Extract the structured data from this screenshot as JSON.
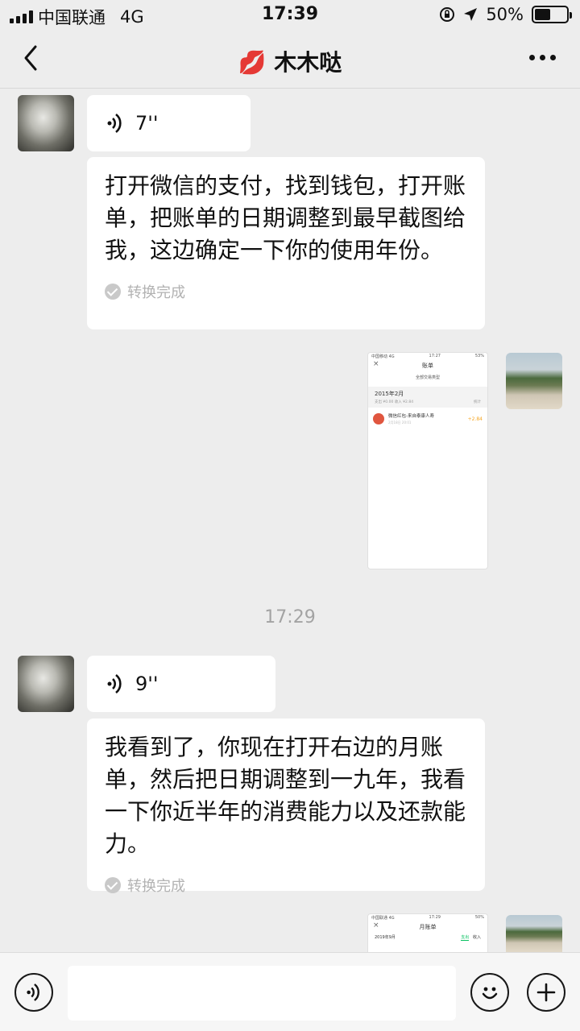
{
  "status_bar": {
    "carrier": "中国联通",
    "network": "4G",
    "time": "17:39",
    "battery": "50%",
    "battery_level": 0.5
  },
  "header": {
    "title": "木木哒",
    "title_emoji": "💋"
  },
  "messages": [
    {
      "side": "left",
      "type": "voice",
      "duration": "7''"
    },
    {
      "side": "left",
      "type": "voice_text",
      "text": "打开微信的支付，找到钱包，打开账单，把账单的日期调整到最早截图给我，这边确定一下你的使用年份。",
      "status": "转换完成"
    },
    {
      "side": "right",
      "type": "image"
    },
    {
      "type": "time",
      "text": "17:29"
    },
    {
      "side": "left",
      "type": "voice",
      "duration": "9''"
    },
    {
      "side": "left",
      "type": "voice_text",
      "text": "我看到了，你现在打开右边的月账单，然后把日期调整到一九年，我看一下你近半年的消费能力以及还款能力。",
      "status": "转换完成"
    },
    {
      "side": "right",
      "type": "image"
    }
  ],
  "shot1": {
    "status_left": "中国移动 4G",
    "status_time": "17:27",
    "status_right": "53%",
    "title": "账单",
    "filter": "全部交易类型",
    "month": "2015年2月",
    "summary": "支出 ¥0.00 收入 ¥2.84",
    "stats": "统计",
    "item_title": "微信红包-来自泰康人寿",
    "item_date": "2月18日 20:01",
    "item_amount": "+2.84"
  },
  "shot2": {
    "status_left": "中国联通 4G",
    "status_time": "17:29",
    "status_right": "50%",
    "title": "月账单",
    "month": "2019年9月",
    "tab_out": "支出",
    "tab_in": "收入"
  }
}
